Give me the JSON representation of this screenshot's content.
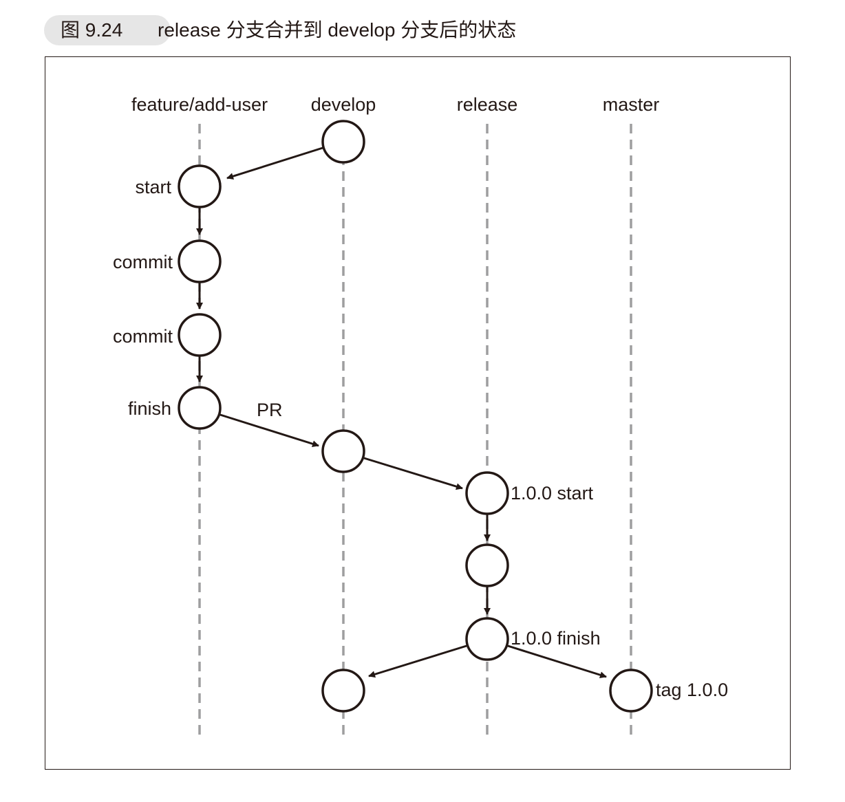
{
  "figure": {
    "label": "图 9.24",
    "title": "release 分支合并到 develop 分支后的状态"
  },
  "branches": [
    "feature/add-user",
    "develop",
    "release",
    "master"
  ],
  "node_labels": {
    "feature_start": "start",
    "feature_commit1": "commit",
    "feature_commit2": "commit",
    "feature_finish": "finish",
    "release_start": "1.0.0 start",
    "release_finish": "1.0.0 finish",
    "master_tag": "tag 1.0.0"
  },
  "edge_labels": {
    "pull_request": "PR"
  },
  "colors": {
    "ink": "#231815",
    "lane": "#9e9e9f",
    "caption_bg": "#e6e6e6"
  }
}
